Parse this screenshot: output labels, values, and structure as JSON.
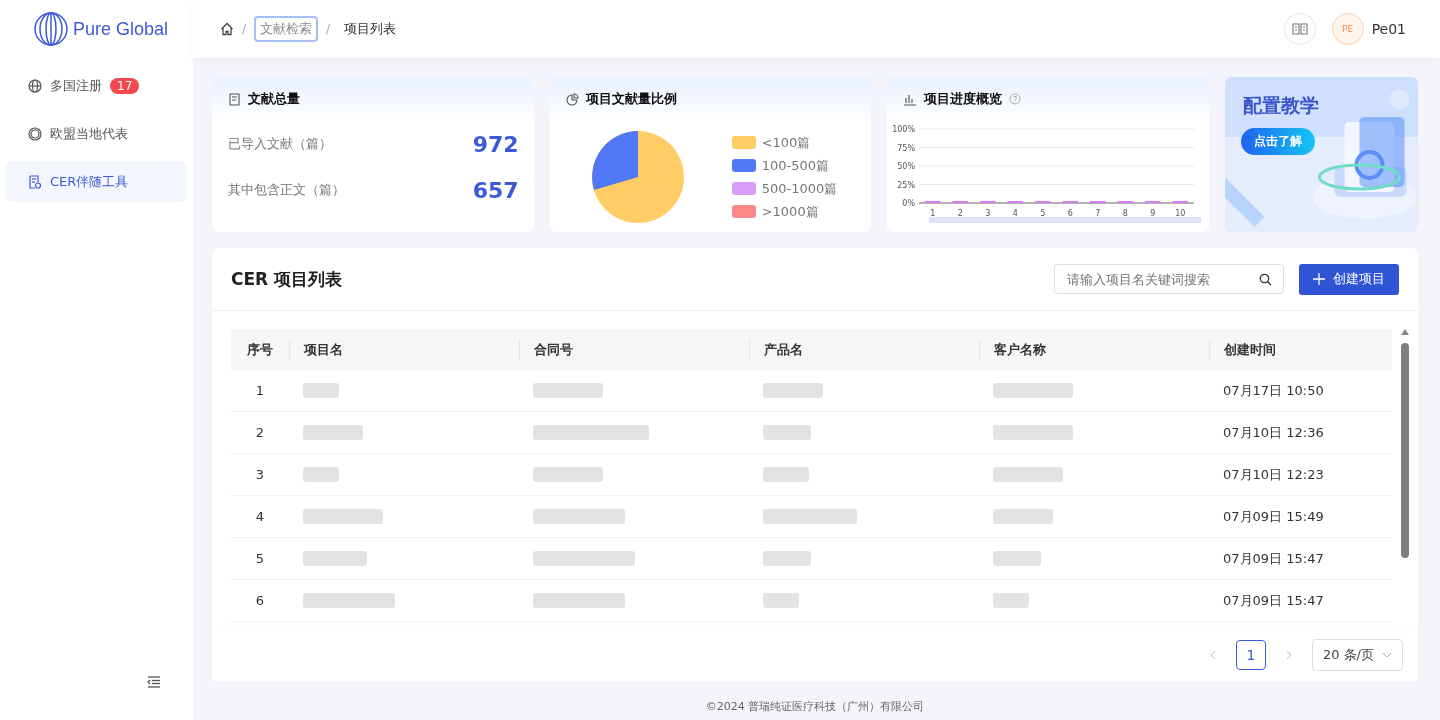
{
  "brand": {
    "name": "Pure Global"
  },
  "sidebar": {
    "items": [
      {
        "label": "多国注册",
        "badge": "17",
        "selected": false
      },
      {
        "label": "欧盟当地代表",
        "selected": false
      },
      {
        "label": "CER伴随工具",
        "selected": true
      }
    ]
  },
  "breadcrumb": [
    {
      "separator": "/",
      "label": "文献检索",
      "focused": true
    },
    {
      "separator": "/",
      "label": "项目列表",
      "focused": false
    }
  ],
  "user": {
    "initials": "PE",
    "name": "Pe01"
  },
  "stats_card": {
    "title": "文献总量",
    "rows": [
      {
        "label": "已导入文献（篇）",
        "value": "972"
      },
      {
        "label": "其中包含正文（篇）",
        "value": "657"
      }
    ]
  },
  "ratio_card": {
    "title": "项目文献量比例",
    "legend": [
      {
        "label": "<100篇",
        "color": "#ffcc66"
      },
      {
        "label": "100-500篇",
        "color": "#5078f7"
      },
      {
        "label": "500-1000篇",
        "color": "#d99cf7"
      },
      {
        "label": ">1000篇",
        "color": "#fb8888"
      }
    ]
  },
  "progress_card": {
    "title": "项目进度概览",
    "chart_data": {
      "type": "bar",
      "categories": [
        "1",
        "2",
        "3",
        "4",
        "5",
        "6",
        "7",
        "8",
        "9",
        "10"
      ],
      "grid": true,
      "series": [
        {
          "color": "#d77cf2",
          "values": [
            0,
            0,
            0,
            0,
            0,
            0,
            0,
            0,
            0,
            0
          ]
        }
      ],
      "ylim": [
        0,
        100
      ],
      "yticks": [
        {
          "value": 0,
          "label": "0%"
        },
        {
          "value": 25,
          "label": "25%"
        },
        {
          "value": 50,
          "label": "50%"
        },
        {
          "value": 75,
          "label": "75%"
        },
        {
          "value": 100,
          "label": "100%"
        }
      ]
    }
  },
  "banner": {
    "title": "配置教学",
    "button": "点击了解"
  },
  "table_panel": {
    "title": "CER 项目列表",
    "search": {
      "placeholder": "请输入项目名关键词搜索"
    },
    "create_button": "创建项目",
    "columns": [
      "序号",
      "项目名",
      "合同号",
      "产品名",
      "客户名称",
      "创建时间"
    ],
    "rows": [
      {
        "number": "1",
        "created": "07月17日 10:50"
      },
      {
        "number": "2",
        "created": "07月10日 12:36"
      },
      {
        "number": "3",
        "created": "07月10日 12:23"
      },
      {
        "number": "4",
        "created": "07月09日 15:49"
      },
      {
        "number": "5",
        "created": "07月09日 15:47"
      },
      {
        "number": "6",
        "created": "07月09日 15:47"
      }
    ]
  },
  "pagination": {
    "pages": [
      {
        "label": "1",
        "selected": true
      }
    ],
    "page_size": "20 条/页"
  },
  "footer": "©2024 普瑞纯证医疗科技（广州）有限公司"
}
